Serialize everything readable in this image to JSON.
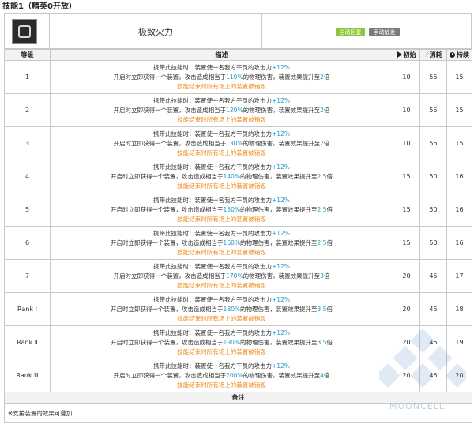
{
  "section_title": "技能1（精英0开放）",
  "skill": {
    "name": "极致火力",
    "tag_auto": "自动回复",
    "tag_manual": "手动触发",
    "icon": "skill-icon"
  },
  "table": {
    "headers": {
      "level": "等级",
      "description": "描述",
      "initial": "初始",
      "cost": "消耗",
      "duration": "持续"
    },
    "rows": [
      {
        "level": "1",
        "line1_pre": "携带此技能时：装置使一名我方干员的攻击力",
        "line1_val": "+12%",
        "line2_pre": "开启时立即获得一个装置，攻击造成相当于",
        "line2_val1": "110%",
        "line2_mid": "的物理伤害，装置效果提升至",
        "line2_val2": "2",
        "line2_suf": "倍",
        "line3": "技能结束时所有场上的装置被销毁",
        "initial": "10",
        "cost": "55",
        "duration": "15"
      },
      {
        "level": "2",
        "line1_pre": "携带此技能时：装置使一名我方干员的攻击力",
        "line1_val": "+12%",
        "line2_pre": "开启时立即获得一个装置，攻击造成相当于",
        "line2_val1": "120%",
        "line2_mid": "的物理伤害，装置效果提升至",
        "line2_val2": "2",
        "line2_suf": "倍",
        "line3": "技能结束时所有场上的装置被销毁",
        "initial": "10",
        "cost": "55",
        "duration": "15"
      },
      {
        "level": "3",
        "line1_pre": "携带此技能时：装置使一名我方干员的攻击力",
        "line1_val": "+12%",
        "line2_pre": "开启时立即获得一个装置，攻击造成相当于",
        "line2_val1": "130%",
        "line2_mid": "的物理伤害，装置效果提升至",
        "line2_val2": "2",
        "line2_suf": "倍",
        "line3": "技能结束时所有场上的装置被销毁",
        "initial": "10",
        "cost": "55",
        "duration": "15"
      },
      {
        "level": "4",
        "line1_pre": "携带此技能时：装置使一名我方干员的攻击力",
        "line1_val": "+12%",
        "line2_pre": "开启时立即获得一个装置，攻击造成相当于",
        "line2_val1": "140%",
        "line2_mid": "的物理伤害，装置效果提升至",
        "line2_val2": "2.5",
        "line2_suf": "倍",
        "line3": "技能结束时所有场上的装置被销毁",
        "initial": "15",
        "cost": "50",
        "duration": "16"
      },
      {
        "level": "5",
        "line1_pre": "携带此技能时：装置使一名我方干员的攻击力",
        "line1_val": "+12%",
        "line2_pre": "开启时立即获得一个装置，攻击造成相当于",
        "line2_val1": "150%",
        "line2_mid": "的物理伤害，装置效果提升至",
        "line2_val2": "2.5",
        "line2_suf": "倍",
        "line3": "技能结束时所有场上的装置被销毁",
        "initial": "15",
        "cost": "50",
        "duration": "16"
      },
      {
        "level": "6",
        "line1_pre": "携带此技能时：装置使一名我方干员的攻击力",
        "line1_val": "+12%",
        "line2_pre": "开启时立即获得一个装置，攻击造成相当于",
        "line2_val1": "160%",
        "line2_mid": "的物理伤害，装置效果提升至",
        "line2_val2": "2.5",
        "line2_suf": "倍",
        "line3": "技能结束时所有场上的装置被销毁",
        "initial": "15",
        "cost": "50",
        "duration": "16"
      },
      {
        "level": "7",
        "line1_pre": "携带此技能时：装置使一名我方干员的攻击力",
        "line1_val": "+12%",
        "line2_pre": "开启时立即获得一个装置，攻击造成相当于",
        "line2_val1": "170%",
        "line2_mid": "的物理伤害，装置效果提升至",
        "line2_val2": "3",
        "line2_suf": "倍",
        "line3": "技能结束时所有场上的装置被销毁",
        "initial": "20",
        "cost": "45",
        "duration": "17"
      },
      {
        "level": "Rank Ⅰ",
        "line1_pre": "携带此技能时：装置使一名我方干员的攻击力",
        "line1_val": "+12%",
        "line2_pre": "开启时立即获得一个装置，攻击造成相当于",
        "line2_val1": "180%",
        "line2_mid": "的物理伤害，装置效果提升至",
        "line2_val2": "3.5",
        "line2_suf": "倍",
        "line3": "技能结束时所有场上的装置被销毁",
        "initial": "20",
        "cost": "45",
        "duration": "18"
      },
      {
        "level": "Rank Ⅱ",
        "line1_pre": "携带此技能时：装置使一名我方干员的攻击力",
        "line1_val": "+12%",
        "line2_pre": "开启时立即获得一个装置，攻击造成相当于",
        "line2_val1": "190%",
        "line2_mid": "的物理伤害，装置效果提升至",
        "line2_val2": "3.5",
        "line2_suf": "倍",
        "line3": "技能结束时所有场上的装置被销毁",
        "initial": "20",
        "cost": "45",
        "duration": "19"
      },
      {
        "level": "Rank Ⅲ",
        "line1_pre": "携带此技能时：装置使一名我方干员的攻击力",
        "line1_val": "+12%",
        "line2_pre": "开启时立即获得一个装置，攻击造成相当于",
        "line2_val1": "200%",
        "line2_mid": "的物理伤害，装置效果提升至",
        "line2_val2": "4",
        "line2_suf": "倍",
        "line3": "技能结束时所有场上的装置被销毁",
        "initial": "20",
        "cost": "45",
        "duration": "20"
      }
    ],
    "note_header": "备注",
    "note": "※支援装置的效果可叠加"
  },
  "watermark": "MOONCELL",
  "colors": {
    "highlight_blue": "#2196c8",
    "highlight_orange": "#f08c1e",
    "tag_green": "#8cc63e",
    "tag_gray": "#7a7a7a"
  }
}
